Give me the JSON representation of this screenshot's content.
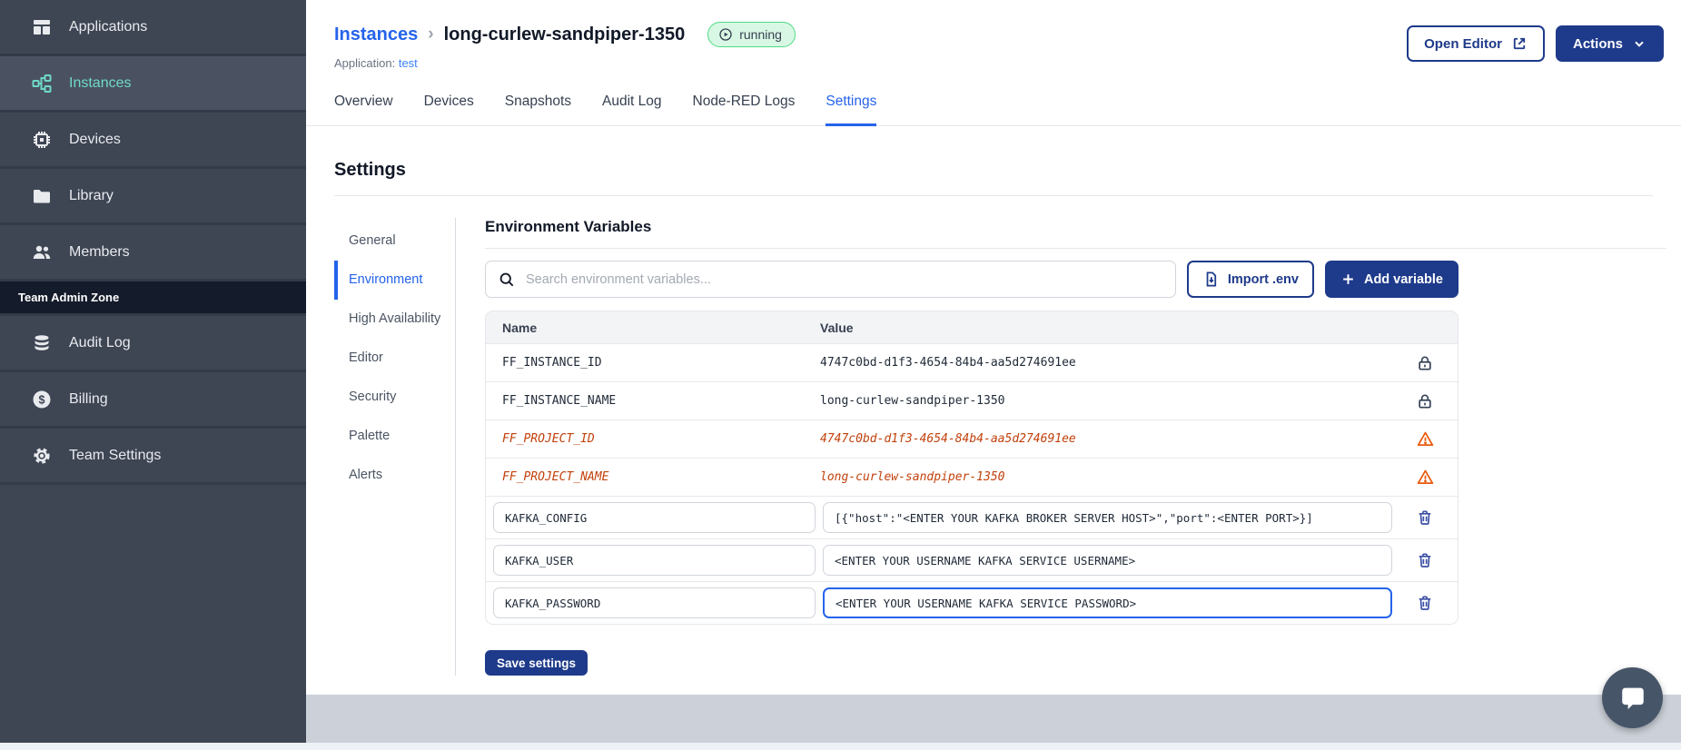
{
  "colors": {
    "primary_button": "#1e3a8a",
    "link_blue": "#2563eb",
    "sidebar_active_teal": "#6fd9c8",
    "sidebar_bg": "#3e4553",
    "admin_zone_bg": "#141b2b",
    "running_badge_bg": "#d9f7e5",
    "running_badge_border": "#4ade80",
    "deprecated_orange": "#c2410c",
    "footer_strip": "#ccd1d9"
  },
  "sidebar": {
    "items": [
      {
        "label": "Applications"
      },
      {
        "label": "Instances"
      },
      {
        "label": "Devices"
      },
      {
        "label": "Library"
      },
      {
        "label": "Members"
      }
    ],
    "section_label": "Team Admin Zone",
    "admin_items": [
      {
        "label": "Audit Log"
      },
      {
        "label": "Billing"
      },
      {
        "label": "Team Settings"
      }
    ]
  },
  "header": {
    "breadcrumb_root": "Instances",
    "breadcrumb_separator": "›",
    "instance_name": "long-curlew-sandpiper-1350",
    "status": "running",
    "application_label": "Application:",
    "application_name": "test",
    "open_editor": "Open Editor",
    "actions": "Actions"
  },
  "tabs": [
    "Overview",
    "Devices",
    "Snapshots",
    "Audit Log",
    "Node-RED Logs",
    "Settings"
  ],
  "active_tab": "Settings",
  "settings": {
    "title": "Settings",
    "nav": [
      "General",
      "Environment",
      "High Availability",
      "Editor",
      "Security",
      "Palette",
      "Alerts"
    ],
    "active_nav": "Environment",
    "env": {
      "title": "Environment Variables",
      "search_placeholder": "Search environment variables...",
      "import_button": "Import .env",
      "add_button": "Add variable",
      "columns": {
        "name": "Name",
        "value": "Value"
      },
      "rows": [
        {
          "name": "FF_INSTANCE_ID",
          "value": "4747c0bd-d1f3-4654-84b4-aa5d274691ee",
          "state": "locked"
        },
        {
          "name": "FF_INSTANCE_NAME",
          "value": "long-curlew-sandpiper-1350",
          "state": "locked"
        },
        {
          "name": "FF_PROJECT_ID",
          "value": "4747c0bd-d1f3-4654-84b4-aa5d274691ee",
          "state": "deprecated"
        },
        {
          "name": "FF_PROJECT_NAME",
          "value": "long-curlew-sandpiper-1350",
          "state": "deprecated"
        },
        {
          "name": "KAFKA_CONFIG",
          "value": "[{\"host\":\"<ENTER YOUR KAFKA BROKER SERVER HOST>\",\"port\":<ENTER PORT>}]",
          "state": "editable"
        },
        {
          "name": "KAFKA_USER",
          "value": "<ENTER YOUR USERNAME KAFKA SERVICE USERNAME>",
          "state": "editable"
        },
        {
          "name": "KAFKA_PASSWORD",
          "value": "<ENTER YOUR USERNAME KAFKA SERVICE PASSWORD>",
          "state": "editable",
          "focused": true
        }
      ],
      "save_button": "Save settings"
    }
  }
}
